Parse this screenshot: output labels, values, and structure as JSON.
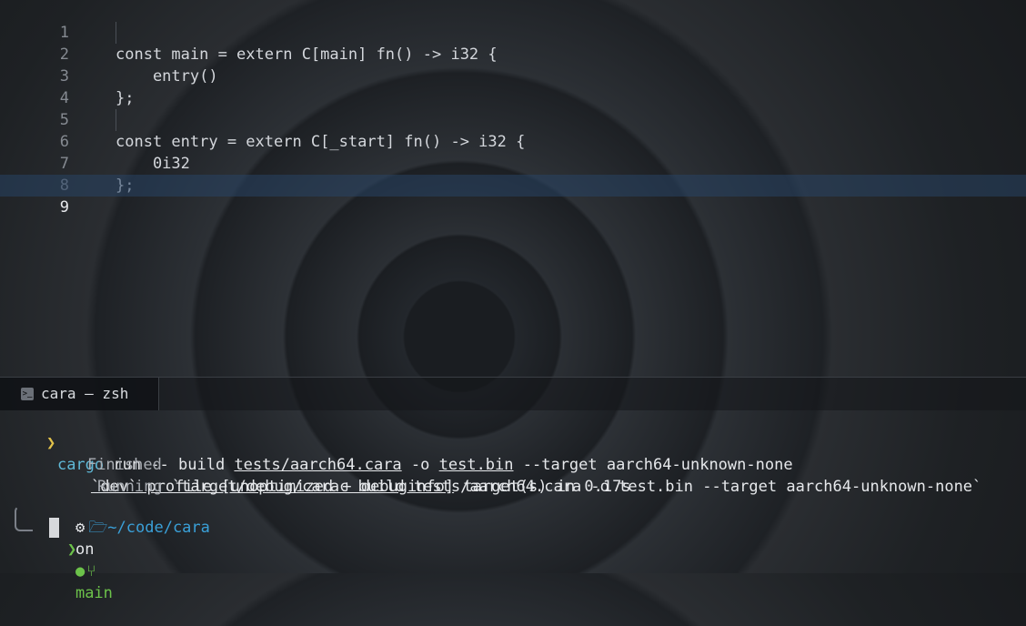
{
  "editor": {
    "lines": [
      {
        "n": "1",
        "text": "const main = extern C[main] fn() -> i32 {"
      },
      {
        "n": "2",
        "text": "    entry()"
      },
      {
        "n": "3",
        "text": "};"
      },
      {
        "n": "4",
        "text": ""
      },
      {
        "n": "5",
        "text": "const entry = extern C[_start] fn() -> i32 {"
      },
      {
        "n": "6",
        "text": "    0i32"
      },
      {
        "n": "7",
        "text": "};"
      },
      {
        "n": "8",
        "text": ""
      },
      {
        "n": "9",
        "text": ""
      }
    ],
    "active_line": "9"
  },
  "terminal": {
    "tab_icon": "terminal-icon",
    "tab_title": "cara — zsh",
    "prompt_symbol": "❯",
    "command": {
      "program": "cargo",
      "part1": " run -- build ",
      "path": "tests/aarch64.cara",
      "part2": " -o ",
      "out": "test.bin",
      "part3": " --target aarch64-unknown-none"
    },
    "finished": {
      "label": "Finished",
      "profile": "`dev` profile [unoptimized + debuginfo]",
      "rest": " target(s) in 0.17s"
    },
    "running": {
      "label": "Running",
      "rest": " `target/debug/carac build tests/aarch64.cara -o test.bin --target aarch64-unknown-none`"
    },
    "prompt": {
      "gear_icon": "gear-icon",
      "folder_icon": "folder-open-icon",
      "dir": "~/code/cara",
      "on": "on",
      "github_icon": "github-icon",
      "branch_icon": "git-branch-icon",
      "branch": "main",
      "input_symbol": "❯"
    }
  },
  "colors": {
    "prompt": "#e2c24a",
    "command": "#5fb8d6",
    "git": "#6cc24a",
    "dir": "#3aa0d8",
    "active_line": "#284464"
  }
}
